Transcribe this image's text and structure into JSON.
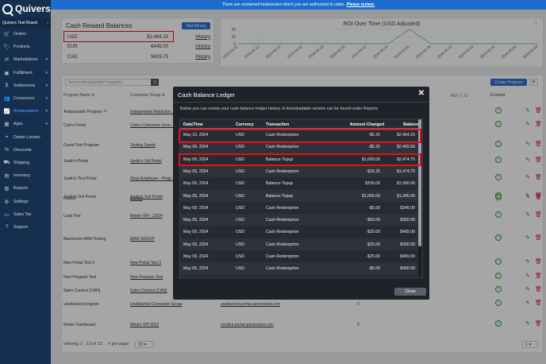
{
  "sidebar": {
    "logo": "Quivers",
    "brand": "Quivers Test Brand",
    "items": [
      {
        "label": "Orders",
        "icon": "cart-icon",
        "caret": ""
      },
      {
        "label": "Products",
        "icon": "tag-icon",
        "caret": ""
      },
      {
        "label": "Marketplaces",
        "icon": "handshake-icon",
        "caret": "▾"
      },
      {
        "label": "Fulfillment",
        "icon": "box-icon",
        "caret": "▾"
      },
      {
        "label": "Settlements",
        "icon": "money-icon",
        "caret": "▾"
      },
      {
        "label": "Consumers",
        "icon": "users-icon",
        "caret": "▾"
      },
      {
        "label": "Ambassadors",
        "icon": "chart-icon",
        "caret": "▾",
        "active": true
      },
      {
        "label": "Apps",
        "icon": "grid-icon",
        "caret": "▾"
      },
      {
        "label": "Dealer Locator",
        "icon": "pin-icon",
        "caret": ""
      },
      {
        "label": "Discounts",
        "icon": "percent-icon",
        "caret": ""
      },
      {
        "label": "Shipping",
        "icon": "truck-icon",
        "caret": ""
      },
      {
        "label": "Inventory",
        "icon": "warehouse-icon",
        "caret": ""
      },
      {
        "label": "Reports",
        "icon": "bar-chart-icon",
        "caret": ""
      },
      {
        "label": "Settings",
        "icon": "gear-icon",
        "caret": ""
      },
      {
        "label": "Sales Tax",
        "icon": "receipt-icon",
        "caret": ""
      },
      {
        "label": "Support",
        "icon": "question-icon",
        "caret": ""
      }
    ]
  },
  "banner": {
    "text": "There are unclaimed businesses which you are authorized to claim.",
    "link": "Please review."
  },
  "cash_card": {
    "title": "Cash Reward Balances",
    "add_money": "Add Money",
    "rows": [
      {
        "code": "USD",
        "amount": "$2,464.25",
        "history": "History"
      },
      {
        "code": "EUR",
        "amount": "€445.00",
        "history": "History"
      },
      {
        "code": "CAD",
        "amount": "$419.75",
        "history": "History"
      }
    ]
  },
  "chart_data": {
    "type": "line",
    "title": "ROI Over Time (USD Adjusted)",
    "x": [
      "2024-04-10",
      "2024-04-12",
      "2024-04-14",
      "2024-04-16",
      "2024-04-18",
      "2024-04-20",
      "2024-04-22",
      "2024-04-24",
      "2024-04-26",
      "2024-04-28",
      "2024-04-30",
      "2024-05-02",
      "2024-05-04",
      "2024-05-06",
      "2024-05-08"
    ],
    "series": [
      {
        "values": [
          0,
          0,
          0,
          0,
          0,
          0,
          0,
          0,
          20,
          0,
          0,
          0,
          0,
          0,
          0
        ]
      }
    ],
    "ylim": [
      0,
      20
    ],
    "yticks": [
      0,
      10,
      20
    ],
    "grid": true,
    "color": "#6fcf7f"
  },
  "table": {
    "search_placeholder": "Search Ambassador Programs...",
    "search_button": "Q",
    "create_button": "Create Program",
    "headers": {
      "name": "Program Name",
      "group": "Consumer Group",
      "roi": "ROI",
      "enabled": "Enabled"
    },
    "rows": [
      {
        "name": "Ambassador Program ™",
        "group": "Independent Retail Em..."
      },
      {
        "name": "Cole's Portal",
        "group": "Cole's Consumer Grou..."
      },
      {
        "name": "Grand Test Program",
        "group": "Testing Speed"
      },
      {
        "name": "Justin's Portal",
        "group": "Justin's 3rd Portal"
      },
      {
        "name": "Justin's Test Portal",
        "group": "Shop Employee - Progr..."
      },
      {
        "name": "Justin's 2nd Portal",
        "group": "Justin's 2nd Portal"
      },
      {
        "name": "Kaaahl",
        "group": "Kaaahl"
      },
      {
        "name": "Load Test",
        "group": "Winter VIP - 23/24"
      },
      {
        "name": "Mackenzie ARM Testing",
        "group": "ARM GROUP"
      },
      {
        "name": "New Portal Test 3",
        "group": "New Portal Test 3"
      },
      {
        "name": "New Program Test",
        "group": "New Program Test"
      },
      {
        "name": "Sales Contest (CAN)",
        "group": "Sales Contest (CAN)"
      },
      {
        "name": "unattached program",
        "group": "Unattached Consumer Group",
        "portal": "unattached.portal.quiverstest.com",
        "count": "0"
      },
      {
        "name": "Winter Dashboard",
        "group": "Winter VIP 2022",
        "portal": "nordica.portal.quiverstest.com",
        "count": "0"
      }
    ],
    "footer_text": "Viewing 1 - 13 of 13",
    "per_page_label": "# per page",
    "per_page": "20",
    "page": "1"
  },
  "modal": {
    "title": "Cash Balance Ledger",
    "close_x": "✕",
    "description": "Below you can review your cash balance ledger history. A downloadable version can be found under Reports.",
    "headers": [
      "Date/Time",
      "Currency",
      "Transaction",
      "Amount Changed",
      "Balance"
    ],
    "rows": [
      [
        "May 10, 2024",
        "USD",
        "Cash Redemption",
        "-$5.25",
        "$2,464.25"
      ],
      [
        "May 09, 2024",
        "USD",
        "Cash Redemption",
        "-$5.25",
        "$2,469.50"
      ],
      [
        "May 09, 2024",
        "USD",
        "Balance Topup",
        "$1,000.00",
        "$2,474.75"
      ],
      [
        "May 09, 2024",
        "USD",
        "Cash Redemption",
        "-$25.25",
        "$1,474.75"
      ],
      [
        "May 09, 2024",
        "USD",
        "Balance Topup",
        "$155.00",
        "$1,500.00"
      ],
      [
        "May 09, 2024",
        "USD",
        "Balance Topup",
        "$1,000.00",
        "$1,345.00"
      ],
      [
        "May 09, 2024",
        "USD",
        "Cash Redemption",
        "-$5.00",
        "$345.00"
      ],
      [
        "May 09, 2024",
        "USD",
        "Cash Redemption",
        "-$55.00",
        "$350.00"
      ],
      [
        "May 09, 2024",
        "USD",
        "Cash Redemption",
        "-$25.00",
        "$405.00"
      ],
      [
        "May 09, 2024",
        "USD",
        "Cash Redemption",
        "-$25.00",
        "$430.00"
      ],
      [
        "May 09, 2024",
        "USD",
        "Cash Redemption",
        "-$25.00",
        "$455.00"
      ],
      [
        "May 06, 2024",
        "USD",
        "Cash Redemption",
        "-$5.00",
        "$480.00"
      ]
    ],
    "close_button": "Close"
  },
  "colors": {
    "sidebar": "#172f4f",
    "banner": "#1b6ed0",
    "accent": "#2c73d2",
    "highlight": "#e3101e"
  }
}
